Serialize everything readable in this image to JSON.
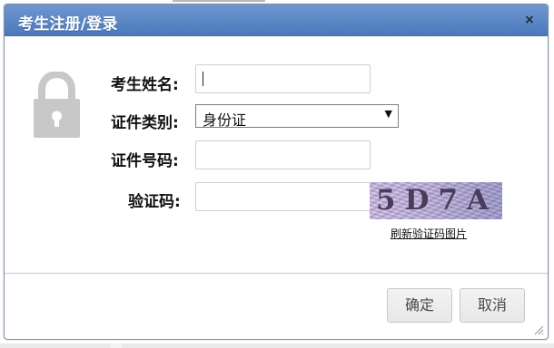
{
  "dialog": {
    "title": "考生注册/登录",
    "close_label": "×"
  },
  "icons": {
    "lock": "lock-icon",
    "close": "close-icon",
    "dropdown": "chevron-down-icon",
    "resize": "resize-grip-icon"
  },
  "form": {
    "name_label": "考生姓名:",
    "name_value": "",
    "id_type_label": "证件类别:",
    "id_type_selected": "身份证",
    "id_number_label": "证件号码:",
    "id_number_value": "",
    "captcha_label": "验证码:",
    "captcha_value": "",
    "captcha_text": "5D7A",
    "captcha_refresh": "刷新验证码图片"
  },
  "actions": {
    "confirm": "确定",
    "cancel": "取消"
  },
  "colors": {
    "title_bar": "#5d88c7",
    "title_text": "#ffffff",
    "button_text": "#4a4a4a",
    "lock_gray": "#c8c8c8"
  }
}
